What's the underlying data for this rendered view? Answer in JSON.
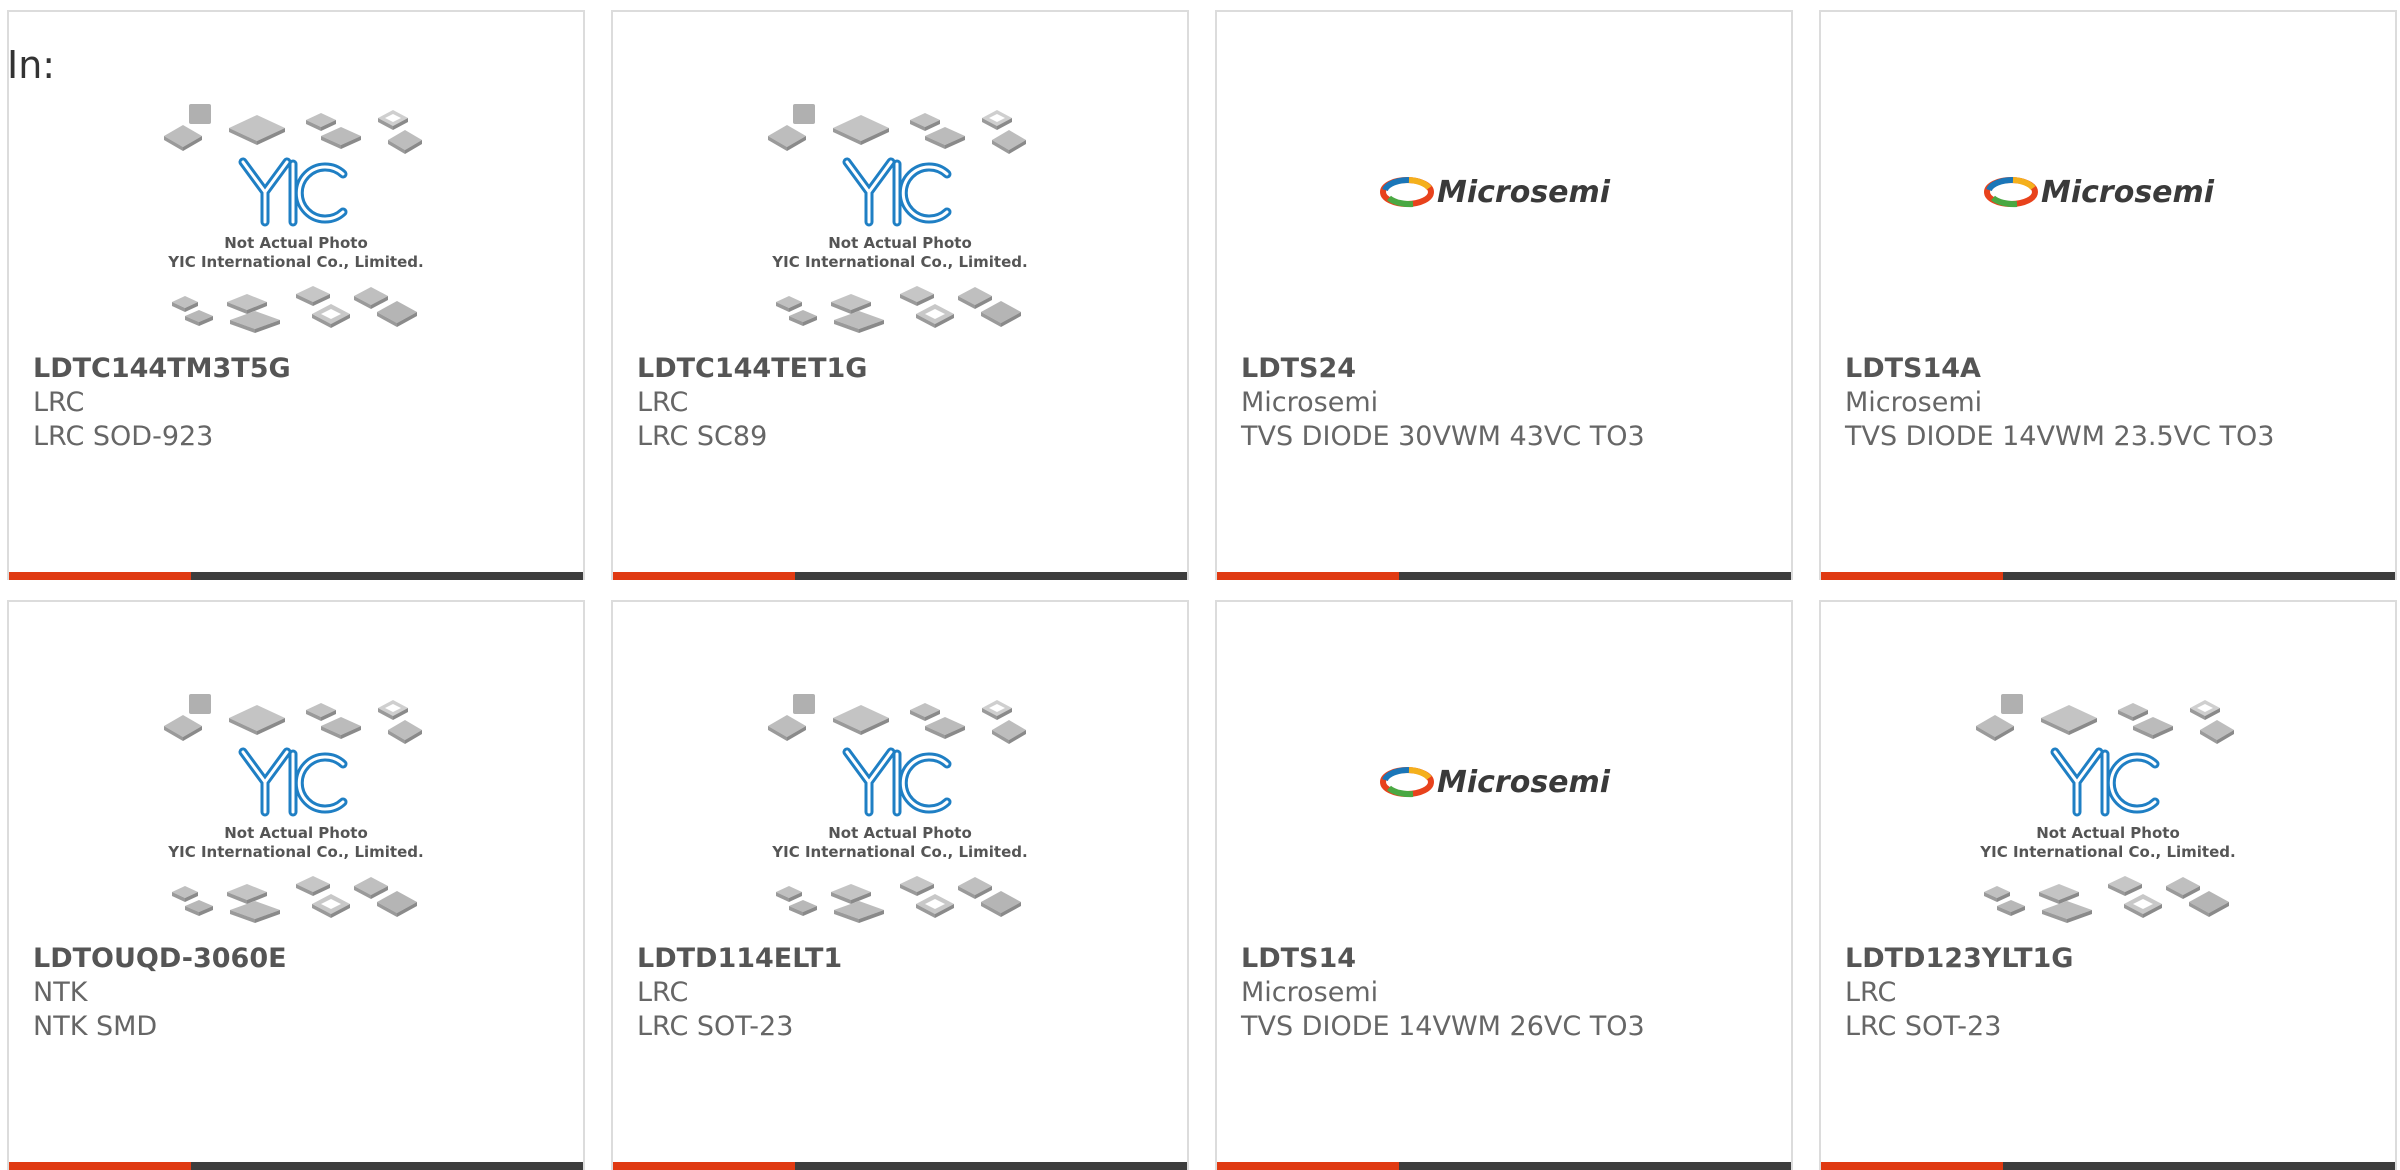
{
  "filter_label": "In:",
  "cards": [
    {
      "part": "LDTC144TM3T5G",
      "maker": "LRC",
      "desc": "LRC SOD-923",
      "image": "yic-placeholder",
      "caption1": "Not Actual Photo",
      "caption2": "YIC International Co., Limited."
    },
    {
      "part": "LDTC144TET1G",
      "maker": "LRC",
      "desc": "LRC SC89",
      "image": "yic-placeholder",
      "caption1": "Not Actual Photo",
      "caption2": "YIC International Co., Limited."
    },
    {
      "part": "LDTS24",
      "maker": "Microsemi",
      "desc": "TVS DIODE 30VWM 43VC TO3",
      "image": "microsemi-logo",
      "logo_text": "Microsemi"
    },
    {
      "part": "LDTS14A",
      "maker": "Microsemi",
      "desc": "TVS DIODE 14VWM 23.5VC TO3",
      "image": "microsemi-logo",
      "logo_text": "Microsemi"
    },
    {
      "part": "LDTOUQD-3060E",
      "maker": "NTK",
      "desc": "NTK SMD",
      "image": "yic-placeholder",
      "caption1": "Not Actual Photo",
      "caption2": "YIC International Co., Limited."
    },
    {
      "part": "LDTD114ELT1",
      "maker": "LRC",
      "desc": "LRC SOT-23",
      "image": "yic-placeholder",
      "caption1": "Not Actual Photo",
      "caption2": "YIC International Co., Limited."
    },
    {
      "part": "LDTS14",
      "maker": "Microsemi",
      "desc": "TVS DIODE 14VWM 26VC TO3",
      "image": "microsemi-logo",
      "logo_text": "Microsemi"
    },
    {
      "part": "LDTD123YLT1G",
      "maker": "LRC",
      "desc": "LRC SOT-23",
      "image": "yic-placeholder",
      "caption1": "Not Actual Photo",
      "caption2": "YIC International Co., Limited."
    }
  ],
  "colors": {
    "accent": "#e03a12",
    "bar": "#3d3d3d",
    "border": "#dcdcdc",
    "yic_blue": "#1f7fc4"
  }
}
